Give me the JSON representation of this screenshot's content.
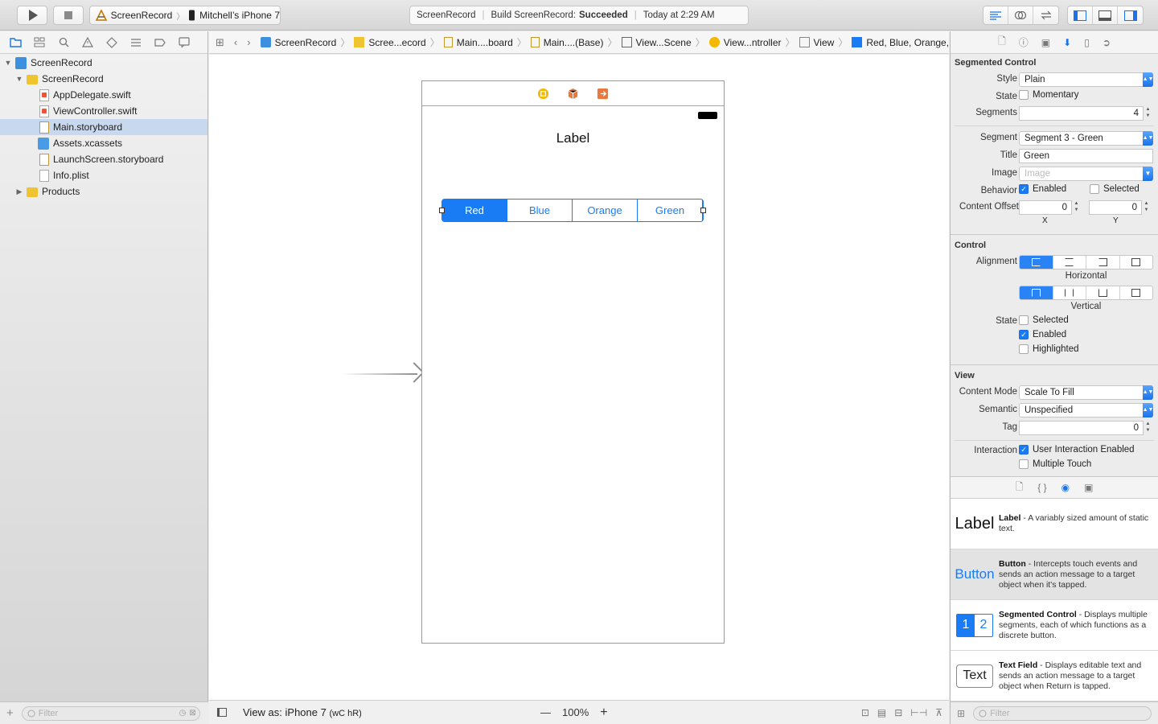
{
  "toolbar": {
    "scheme_name": "ScreenRecord",
    "device_name": "Mitchell’s iPhone 7",
    "activity": {
      "project": "ScreenRecord",
      "status_prefix": "Build ScreenRecord:",
      "status_result": "Succeeded",
      "time": "Today at 2:29 AM"
    }
  },
  "navigator": {
    "items": [
      {
        "label": "ScreenRecord"
      },
      {
        "label": "ScreenRecord"
      },
      {
        "label": "AppDelegate.swift"
      },
      {
        "label": "ViewController.swift"
      },
      {
        "label": "Main.storyboard"
      },
      {
        "label": "Assets.xcassets"
      },
      {
        "label": "LaunchScreen.storyboard"
      },
      {
        "label": "Info.plist"
      },
      {
        "label": "Products"
      }
    ],
    "filter_placeholder": "Filter"
  },
  "jumpbar": {
    "crumbs": [
      "ScreenRecord",
      "Scree...ecord",
      "Main....board",
      "Main....(Base)",
      "View...Scene",
      "View...ntroller",
      "View",
      "Red, Blue, Orange, Green"
    ]
  },
  "canvas": {
    "label_text": "Label",
    "segments": [
      "Red",
      "Blue",
      "Orange",
      "Green"
    ],
    "selected_segment": 0
  },
  "editor_bottom": {
    "view_as": "View as: iPhone 7",
    "size_class": "(wC hR)",
    "zoom": "100%",
    "zoom_minus": "—",
    "zoom_plus": "+"
  },
  "inspector": {
    "segmented": {
      "title": "Segmented Control",
      "style_label": "Style",
      "style_value": "Plain",
      "state_label": "State",
      "momentary": "Momentary",
      "segments_label": "Segments",
      "segments_value": "4",
      "segment_label": "Segment",
      "segment_value": "Segment 3 - Green",
      "title_label": "Title",
      "title_value": "Green",
      "image_label": "Image",
      "image_placeholder": "Image",
      "behavior_label": "Behavior",
      "enabled": "Enabled",
      "selected": "Selected",
      "offset_label": "Content Offset",
      "offset_x": "0",
      "offset_y": "0",
      "x_cap": "X",
      "y_cap": "Y"
    },
    "control": {
      "title": "Control",
      "alignment_label": "Alignment",
      "horizontal": "Horizontal",
      "vertical": "Vertical",
      "state_label": "State",
      "selected": "Selected",
      "enabled": "Enabled",
      "highlighted": "Highlighted"
    },
    "view": {
      "title": "View",
      "content_mode_label": "Content Mode",
      "content_mode_value": "Scale To Fill",
      "semantic_label": "Semantic",
      "semantic_value": "Unspecified",
      "tag_label": "Tag",
      "tag_value": "0",
      "interaction_label": "Interaction",
      "user_interaction": "User Interaction Enabled",
      "multiple_touch": "Multiple Touch"
    }
  },
  "library": {
    "items": [
      {
        "thumb": "Label",
        "name": "Label",
        "desc": " - A variably sized amount of static text."
      },
      {
        "thumb": "Button",
        "name": "Button",
        "desc": " - Intercepts touch events and sends an action message to a target object when it's tapped."
      },
      {
        "thumb_1": "1",
        "thumb_2": "2",
        "name": "Segmented Control",
        "desc": " - Displays multiple segments, each of which functions as a discrete button."
      },
      {
        "thumb": "Text",
        "name": "Text Field",
        "desc": " - Displays editable text and sends an action message to a target object when Return is tapped."
      }
    ],
    "filter_placeholder": "Filter"
  },
  "colors": {
    "accent": "#1a7cf5",
    "selection": "#c7d8ef"
  }
}
